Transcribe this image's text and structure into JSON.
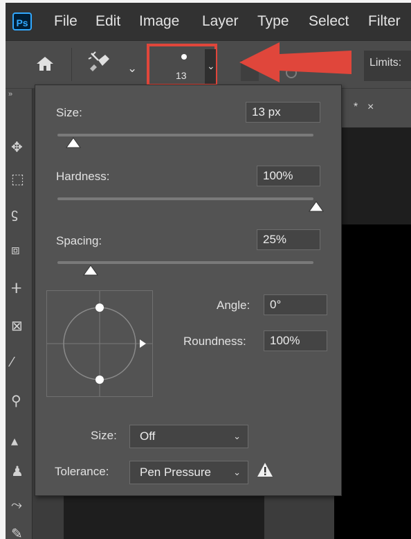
{
  "app": {
    "logo": "Ps",
    "menu": [
      "File",
      "Edit",
      "Image",
      "Layer",
      "Type",
      "Select",
      "Filter"
    ]
  },
  "options_bar": {
    "brush_size_value": "13",
    "limits_label": "Limits:"
  },
  "document": {
    "tab_modified_marker": "*",
    "tab_close": "×"
  },
  "brush_panel": {
    "size": {
      "label": "Size:",
      "value": "13 px",
      "slider_fraction": 0.05
    },
    "hardness": {
      "label": "Hardness:",
      "value": "100%",
      "slider_fraction": 1.0
    },
    "spacing": {
      "label": "Spacing:",
      "value": "25%",
      "slider_fraction": 0.12
    },
    "angle": {
      "label": "Angle:",
      "value": "0°"
    },
    "roundness": {
      "label": "Roundness:",
      "value": "100%"
    },
    "size_control": {
      "label": "Size:",
      "selected": "Off"
    },
    "tolerance": {
      "label": "Tolerance:",
      "selected": "Pen Pressure"
    }
  },
  "icons": [
    "photoshop-logo-icon",
    "home-icon",
    "brush-tool-icon",
    "chevron-down-icon",
    "warning-icon",
    "collapse-panel-icon"
  ],
  "colors": {
    "highlight_box": "#e0463b",
    "arrow": "#e0463b",
    "panel_bg": "#535353",
    "menubar_bg": "#323232",
    "ps_blue": "#31a8ff"
  }
}
